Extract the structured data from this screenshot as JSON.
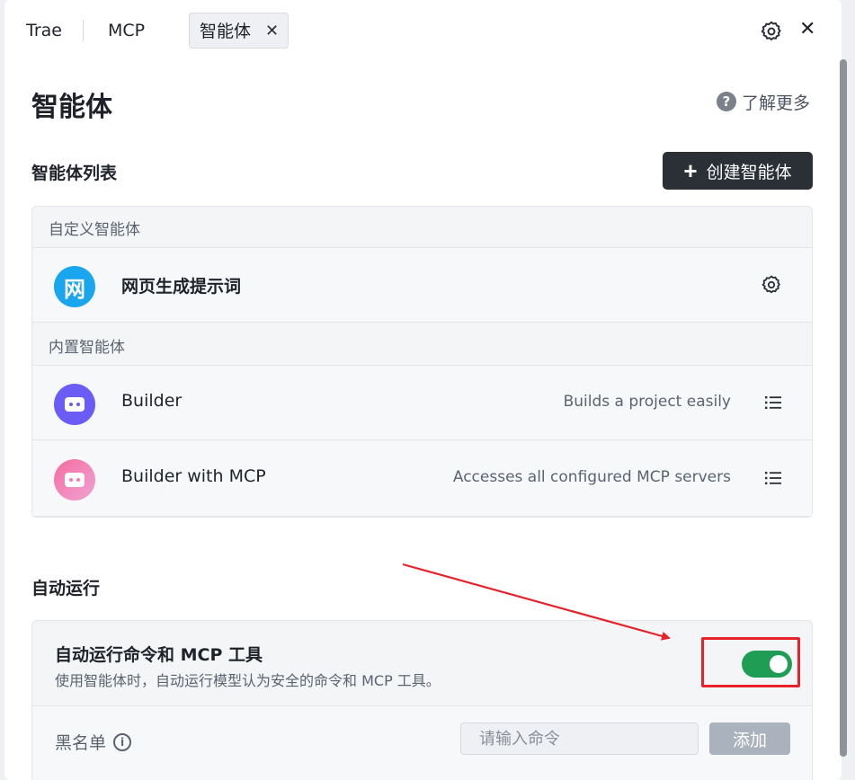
{
  "tabs": [
    {
      "label": "Trae"
    },
    {
      "label": "MCP"
    },
    {
      "label": "智能体"
    }
  ],
  "page": {
    "title": "智能体",
    "learn_more": "了解更多"
  },
  "agents": {
    "section_title": "智能体列表",
    "create_label": "创建智能体",
    "custom_label": "自定义智能体",
    "builtin_label": "内置智能体",
    "custom": [
      {
        "avatar_text": "网",
        "name": "网页生成提示词"
      }
    ],
    "builtin": [
      {
        "name": "Builder",
        "desc": "Builds a project easily"
      },
      {
        "name": "Builder with MCP",
        "desc": "Accesses all configured MCP servers"
      }
    ]
  },
  "auto_run": {
    "section_title": "自动运行",
    "title": "自动运行命令和 MCP 工具",
    "subtitle": "使用智能体时，自动运行模型认为安全的命令和 MCP 工具。",
    "enabled": true,
    "blacklist_label": "黑名单",
    "input_placeholder": "请输入命令",
    "add_label": "添加"
  },
  "icons": {
    "help": "question-circle-icon",
    "gear": "gear-icon",
    "close": "close-icon",
    "menu": "list-menu-icon",
    "info": "info-icon"
  },
  "colors": {
    "primary_button": "#2b2f36",
    "toggle_on": "#1f9d55",
    "highlight": "#e8212a",
    "avatar_blue": "#1aa6ee",
    "avatar_purple": "#6b5cf5"
  }
}
